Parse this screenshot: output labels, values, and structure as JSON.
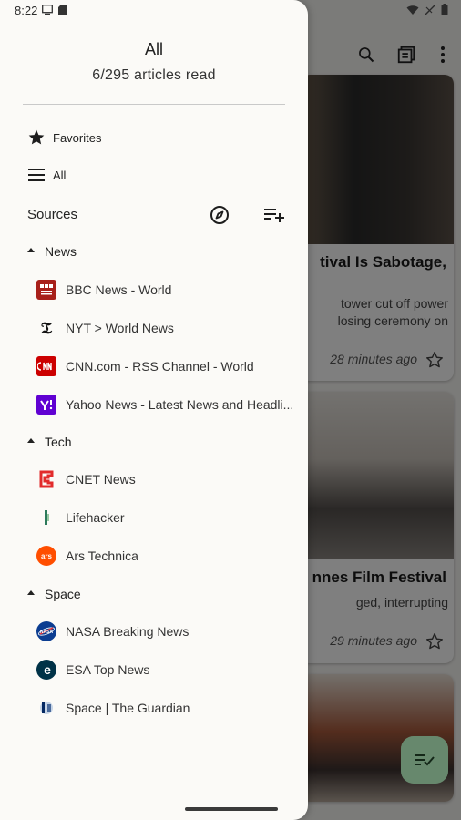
{
  "status_bar": {
    "time": "8:22"
  },
  "drawer": {
    "title": "All",
    "subtitle": "6/295 articles read",
    "nav": [
      {
        "label": "Favorites",
        "icon": "star-filled-icon"
      },
      {
        "label": "All",
        "icon": "menu-lines-icon"
      }
    ],
    "sources": {
      "label": "Sources",
      "explore_icon": "compass-icon",
      "add_icon": "playlist-add-icon"
    },
    "groups": [
      {
        "name": "News",
        "feeds": [
          {
            "label": "BBC News - World",
            "icon": "bbc-icon",
            "color": "#b31b1b"
          },
          {
            "label": "NYT > World News",
            "icon": "nyt-icon",
            "color": "#111111"
          },
          {
            "label": "CNN.com - RSS Channel - World",
            "icon": "cnn-icon",
            "color": "#cc0000"
          },
          {
            "label": "Yahoo News - Latest News and Headlines",
            "icon": "yahoo-icon",
            "color": "#6001d2"
          }
        ]
      },
      {
        "name": "Tech",
        "feeds": [
          {
            "label": "CNET News",
            "icon": "cnet-icon",
            "color": "#e22b2b"
          },
          {
            "label": "Lifehacker",
            "icon": "lifehacker-icon",
            "color": "#2c7a5b"
          },
          {
            "label": "Ars Technica",
            "icon": "ars-technica-icon",
            "color": "#ff4e00"
          }
        ]
      },
      {
        "name": "Space",
        "feeds": [
          {
            "label": "NASA Breaking News",
            "icon": "nasa-icon",
            "color": "#0b3d91"
          },
          {
            "label": "ESA Top News",
            "icon": "esa-icon",
            "color": "#003247"
          },
          {
            "label": "Space | The Guardian",
            "icon": "guardian-icon",
            "color": "#052962"
          }
        ]
      }
    ]
  },
  "background": {
    "cards": [
      {
        "title": "tival Is Sabotage,",
        "snippet": [
          "tower cut off power",
          "losing ceremony on"
        ],
        "time": "28 minutes ago"
      },
      {
        "title": "nnes Film Festival",
        "snippet": [
          "ged, interrupting"
        ],
        "time": "29 minutes ago"
      }
    ]
  }
}
